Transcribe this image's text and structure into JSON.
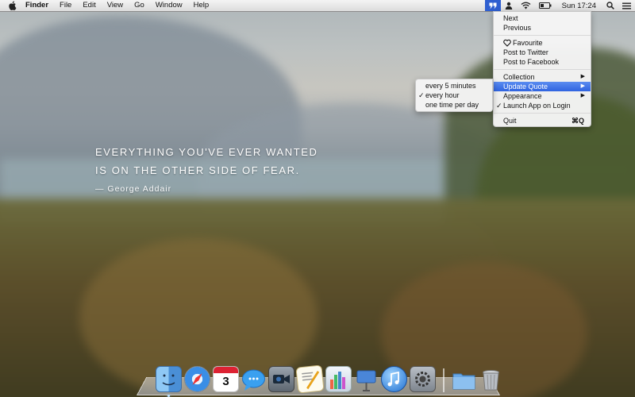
{
  "menubar": {
    "app_name": "Finder",
    "menus": [
      "File",
      "Edit",
      "View",
      "Go",
      "Window",
      "Help"
    ],
    "clock": "Sun 17:24"
  },
  "quote": {
    "line1": "EVERYTHING YOU'VE EVER WANTED",
    "line2": "IS ON THE OTHER SIDE OF FEAR.",
    "author": "— George Addair"
  },
  "menu": {
    "next": "Next",
    "previous": "Previous",
    "favourite": "Favourite",
    "post_twitter": "Post to Twitter",
    "post_facebook": "Post to Facebook",
    "collection": "Collection",
    "update_quote": "Update Quote",
    "appearance": "Appearance",
    "launch_on_login": "Launch App on Login",
    "launch_checked": true,
    "quit": "Quit",
    "quit_shortcut": "⌘Q",
    "highlight_color": "#2f63e0"
  },
  "submenu": {
    "items": [
      "every 5 minutes",
      "every hour",
      "one time per day"
    ],
    "checked": "every hour"
  },
  "dock": {
    "calendar_day": "3",
    "apps": [
      "finder",
      "safari",
      "calendar",
      "messages",
      "facetime",
      "textedit",
      "numbers",
      "keynote",
      "itunes",
      "system-preferences",
      "applications-folder",
      "trash"
    ]
  }
}
